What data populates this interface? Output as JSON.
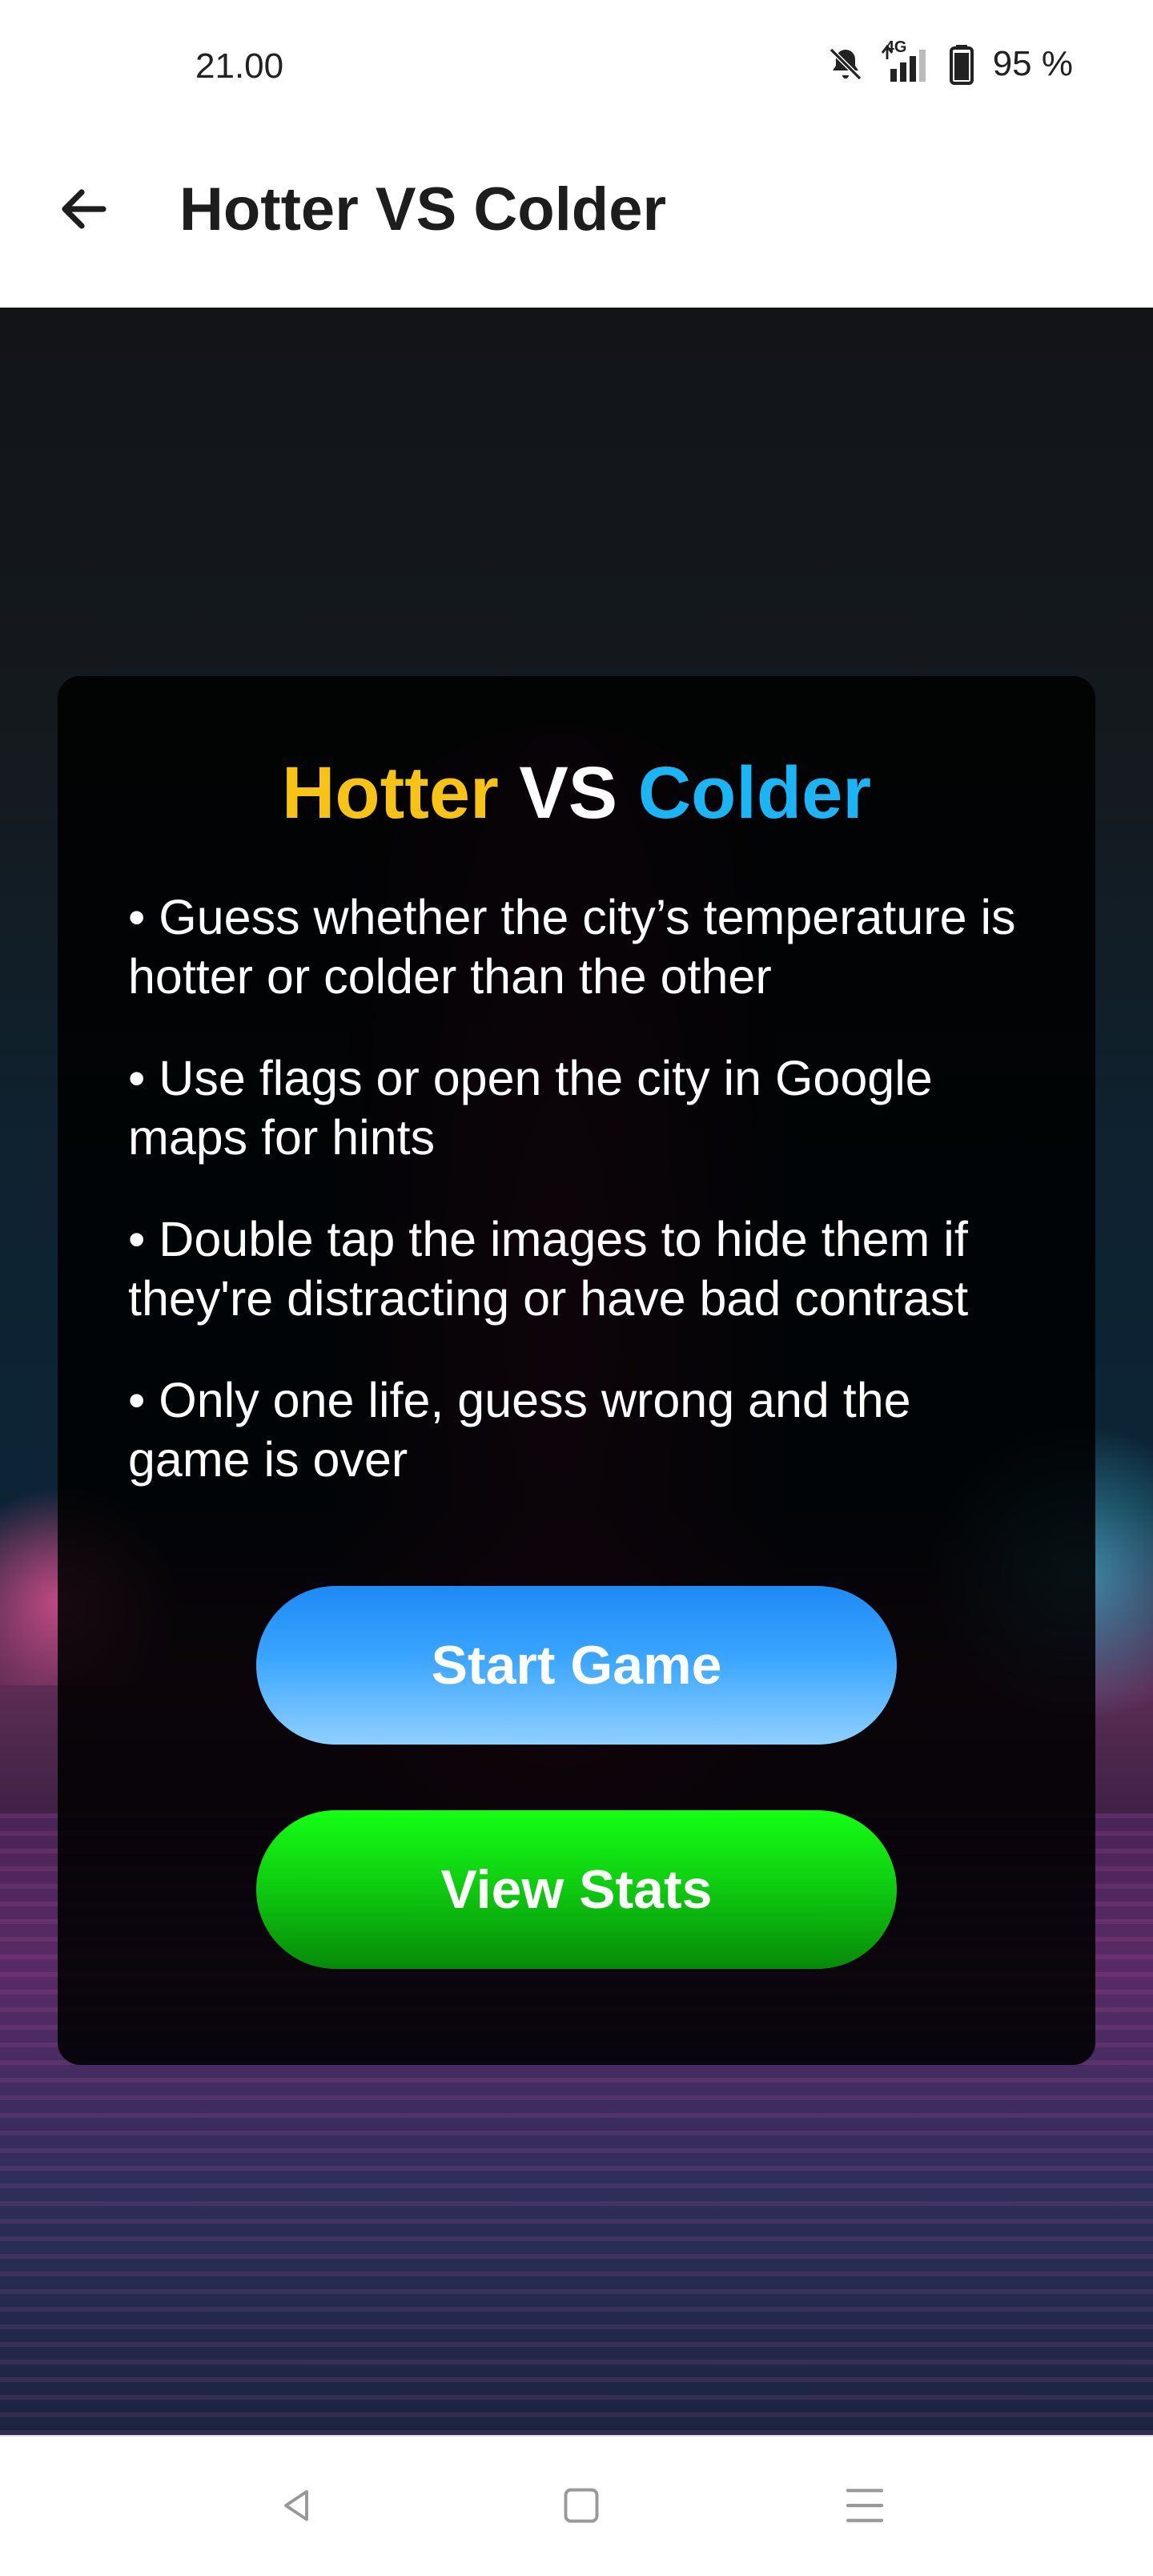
{
  "status_bar": {
    "time": "21.00",
    "network": "4G",
    "battery": "95 %"
  },
  "app_bar": {
    "title": "Hotter VS Colder"
  },
  "card": {
    "title_hot": "Hotter",
    "title_vs": "VS",
    "title_cold": "Colder",
    "rules": [
      "• Guess whether the city’s temperature is hotter or colder than the other",
      "• Use flags or open the city in Google maps for hints",
      "• Double tap the images to hide them if they're distracting or have bad contrast",
      "• Only one life, guess wrong and the game is over"
    ],
    "start_button": "Start Game",
    "stats_button": "View Stats"
  },
  "colors": {
    "hot": "#f7c415",
    "cold": "#1bb5f5",
    "start_button": "#3aa5ff",
    "stats_button": "#0fcf10"
  },
  "icons": {
    "back": "arrow-left-icon",
    "mute": "bell-off-icon",
    "signal": "signal-icon",
    "battery": "battery-icon",
    "nav_back": "triangle-back-icon",
    "nav_home": "square-home-icon",
    "nav_menu": "menu-lines-icon"
  }
}
